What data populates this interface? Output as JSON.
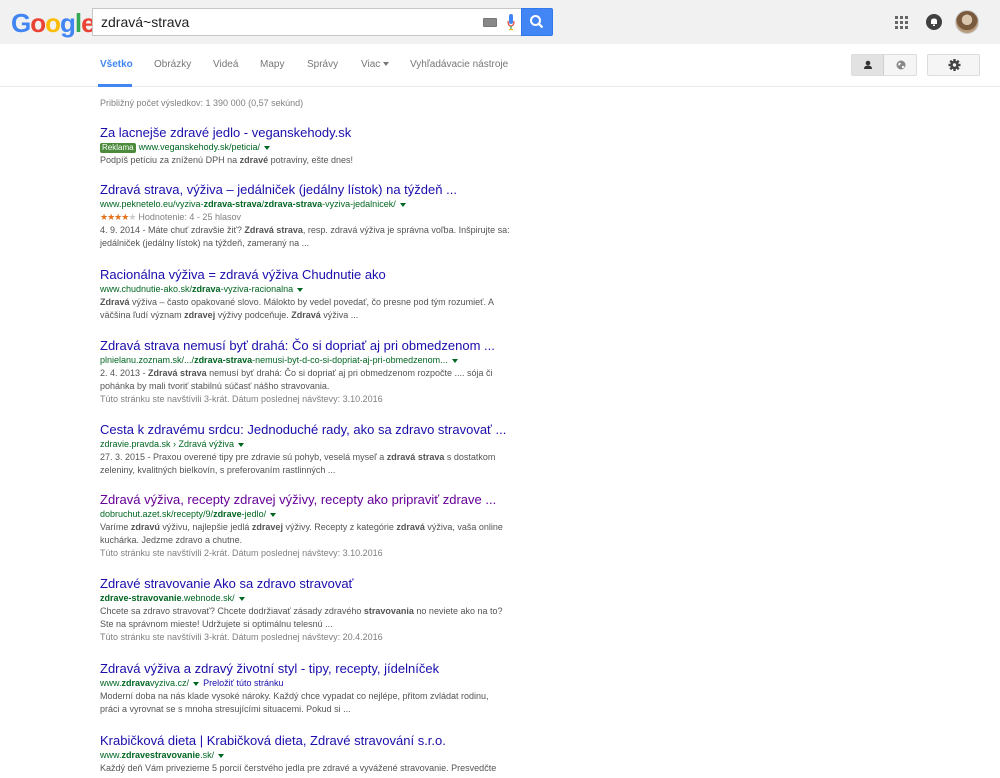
{
  "header": {
    "logo_letters": [
      {
        "ch": "G",
        "color": "#4285f4"
      },
      {
        "ch": "o",
        "color": "#ea4335"
      },
      {
        "ch": "o",
        "color": "#fbbc05"
      },
      {
        "ch": "g",
        "color": "#4285f4"
      },
      {
        "ch": "l",
        "color": "#34a853"
      },
      {
        "ch": "e",
        "color": "#ea4335"
      }
    ],
    "search_query": "zdravá~strava",
    "icons": [
      "keyboard-icon",
      "microphone-icon",
      "search-icon",
      "apps-grid-icon",
      "notifications-icon",
      "avatar"
    ]
  },
  "tabs": {
    "all": "Všetko",
    "images": "Obrázky",
    "videos": "Videá",
    "maps": "Mapy",
    "news": "Správy",
    "more": "Viac",
    "tools": "Vyhľadávacie nástroje"
  },
  "colors": {
    "accent": "#4285f4",
    "link": "#1a0dab",
    "visited_link": "#660099",
    "url_green": "#006621",
    "snippet_gray": "#545454",
    "ad_badge": "#4b8b3b",
    "stars": "#e7711b"
  },
  "stats": "Približný počet výsledkov: 1 390 000 (0,57 sekúnd)",
  "results": [
    {
      "title": "Za lacnejše zdravé jedlo - veganskehody.sk",
      "ad_label": "Reklama",
      "url": "www.veganskehody.sk/peticia/",
      "snippet_parts": [
        "Podpíš petíciu za zníženú DPH na ",
        "zdravé",
        " potraviny, ešte dnes!"
      ]
    },
    {
      "title": "Zdravá strava, výživa – jedálniček (jedálny lístok) na týždeň ...",
      "url_parts": [
        "www.peknetelo.eu/vyziva-",
        "zdrava-strava",
        "/",
        "zdrava-strava",
        "-vyziva-jedalnicek/"
      ],
      "rating_stars": 4,
      "rating_text": "Hodnotenie: 4 - 25 hlasov",
      "snippet_line1_parts": [
        "4. 9. 2014 - Máte chuť zdravšie žiť? ",
        "Zdravá strava",
        ", resp. zdravá výživa je správna voľba. Inšpirujte sa:"
      ],
      "snippet_line2": "jedálniček (jedálny lístok) na týždeň, zameraný na ..."
    },
    {
      "title": "Racionálna výživa = zdravá výživa Chudnutie ako",
      "url_parts": [
        "www.chudnutie-ako.sk/",
        "zdrava",
        "-vyziva-racionalna"
      ],
      "snippet_line1_parts": [
        "Zdravá",
        " výživa – často opakované slovo. Málokto by vedel povedať, čo presne pod tým rozumieť. A"
      ],
      "snippet_line2_parts": [
        "väčšina ľudí význam ",
        "zdravej",
        " výživy podceňuje. ",
        "Zdravá",
        " výživa ..."
      ]
    },
    {
      "title": "Zdravá strava nemusí byť drahá: Čo si dopriať aj pri obmedzenom ...",
      "url_parts": [
        "plnielanu.zoznam.sk/.../",
        "zdrava-strava",
        "-nemusi-byt-d-co-si-dopriat-aj-pri-obmedzenom..."
      ],
      "snippet_line1_parts": [
        "2. 4. 2013 - ",
        "Zdravá strava",
        " nemusí byť drahá: Čo si dopriať aj pri obmedzenom rozpočte .... sója či"
      ],
      "snippet_line2": "pohánka by mali tvoriť stabilnú súčasť nášho stravovania.",
      "visited_note": "Túto stránku ste navštívili 3-krát. Dátum poslednej návštevy: 3.10.2016"
    },
    {
      "title": "Cesta k zdravému srdcu: Jednoduché rady, ako sa zdravo stravovať ...",
      "url_parts": [
        "zdravie.pravda.sk › Zdravá výživa"
      ],
      "snippet_line1_parts": [
        "27. 3. 2015 - Praxou overené tipy pre zdravie sú pohyb, veselá myseľ a ",
        "zdravá strava",
        " s dostatkom"
      ],
      "snippet_line2": "zeleniny, kvalitných bielkovín, s preferovaním rastlinných ..."
    },
    {
      "title": "Zdravá výživa, recepty zdravej výživy, recepty ako pripraviť zdrave ...",
      "url_parts": [
        "dobruchut.azet.sk/recepty/9/",
        "zdrave",
        "-jedlo/"
      ],
      "snippet_line1_parts": [
        "Varíme ",
        "zdravú",
        " výživu, najlepšie jedlá ",
        "zdravej",
        " výživy. Recepty z kategórie ",
        "zdravá",
        " výživa, vaša online"
      ],
      "snippet_line2": "kuchárka. Jedzme zdravo a chutne.",
      "visited_note": "Túto stránku ste navštívili 2-krát. Dátum poslednej návštevy: 3.10.2016"
    },
    {
      "title": "Zdravé stravovanie Ako sa zdravo stravovať",
      "url_parts": [
        "",
        "zdrave-stravovanie",
        ".webnode.sk/"
      ],
      "snippet_line1_parts": [
        "Chcete sa zdravo stravovať? Chcete dodržiavať zásady zdravého ",
        "stravovania",
        " no neviete ako na to?"
      ],
      "snippet_line2": "Ste na správnom mieste! Udržujete si optimálnu telesnú ...",
      "visited_note": "Túto stránku ste navštívili 3-krát. Dátum poslednej návštevy: 20.4.2016"
    },
    {
      "title": "Zdravá výživa a zdravý životní styl - tipy, recepty, jídelníček",
      "url_parts": [
        "www.",
        "zdrava",
        "vyziva.cz/"
      ],
      "translate_label": "Preložiť túto stránku",
      "snippet_line1": "Moderní doba na nás klade vysoké nároky. Každý chce vypadat co nejlépe, přitom zvládat rodinu,",
      "snippet_line2": "práci a vyrovnat se s mnoha stresujícími situacemi. Pokud si ..."
    },
    {
      "title": "Krabičková dieta | Krabičková dieta, Zdravé stravování s.r.o.",
      "url_parts": [
        "www.",
        "zdravestravovanie",
        ".sk/"
      ],
      "snippet_line1": "Každý deň Vám privezieme 5 porcií čerstvého jedla pre zdravé a vyvážené stravovanie. Presvedčte"
    }
  ]
}
